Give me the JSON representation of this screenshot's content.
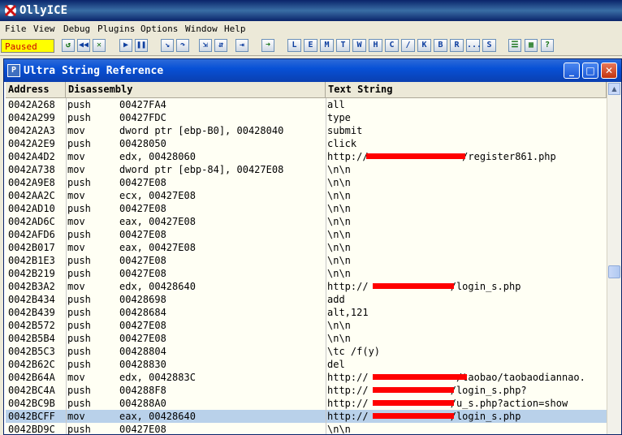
{
  "app": {
    "title": "OllyICE"
  },
  "menu": [
    "File",
    "View",
    "Debug",
    "Plugins",
    "Options",
    "Window",
    "Help"
  ],
  "toolbar": {
    "status": "Paused",
    "letters": [
      "L",
      "E",
      "M",
      "T",
      "W",
      "H",
      "C",
      "/",
      "K",
      "B",
      "R",
      "...",
      "S"
    ]
  },
  "window": {
    "title": "Ultra String Reference",
    "icon_letter": "P",
    "buttons": {
      "minimize": "_",
      "maximize": "□",
      "close": "✕"
    }
  },
  "table": {
    "columns": [
      "Address",
      "Disassembly",
      "Text String"
    ],
    "rows": [
      {
        "addr": "0042A268",
        "op": "push",
        "arg": "00427FA4",
        "text": "all"
      },
      {
        "addr": "0042A299",
        "op": "push",
        "arg": "00427FDC",
        "text": "type"
      },
      {
        "addr": "0042A2A3",
        "op": "mov",
        "arg": "dword ptr [ebp-B0], 00428040",
        "text": "submit"
      },
      {
        "addr": "0042A2E9",
        "op": "push",
        "arg": "00428050",
        "text": "click"
      },
      {
        "addr": "0042A4D2",
        "op": "mov",
        "arg": "edx, 00428060",
        "text": "http://                /register861.php"
      },
      {
        "addr": "0042A738",
        "op": "mov",
        "arg": "dword ptr [ebp-84], 00427E08",
        "text": "\\n\\n"
      },
      {
        "addr": "0042A9E8",
        "op": "push",
        "arg": "00427E08",
        "text": "\\n\\n"
      },
      {
        "addr": "0042AA2C",
        "op": "mov",
        "arg": "ecx, 00427E08",
        "text": "\\n\\n"
      },
      {
        "addr": "0042AD10",
        "op": "push",
        "arg": "00427E08",
        "text": "\\n\\n"
      },
      {
        "addr": "0042AD6C",
        "op": "mov",
        "arg": "eax, 00427E08",
        "text": "\\n\\n"
      },
      {
        "addr": "0042AFD6",
        "op": "push",
        "arg": "00427E08",
        "text": "\\n\\n"
      },
      {
        "addr": "0042B017",
        "op": "mov",
        "arg": "eax, 00427E08",
        "text": "\\n\\n"
      },
      {
        "addr": "0042B1E3",
        "op": "push",
        "arg": "00427E08",
        "text": "\\n\\n"
      },
      {
        "addr": "0042B219",
        "op": "push",
        "arg": "00427E08",
        "text": "\\n\\n"
      },
      {
        "addr": "0042B3A2",
        "op": "mov",
        "arg": "edx, 00428640",
        "text": "http://              /login_s.php"
      },
      {
        "addr": "0042B434",
        "op": "push",
        "arg": "00428698",
        "text": "add"
      },
      {
        "addr": "0042B439",
        "op": "push",
        "arg": "00428684",
        "text": "alt,121"
      },
      {
        "addr": "0042B572",
        "op": "push",
        "arg": "00427E08",
        "text": "\\n\\n"
      },
      {
        "addr": "0042B5B4",
        "op": "push",
        "arg": "00427E08",
        "text": "\\n\\n"
      },
      {
        "addr": "0042B5C3",
        "op": "push",
        "arg": "00428804",
        "text": "\\tc /f(y)"
      },
      {
        "addr": "0042B62C",
        "op": "push",
        "arg": "00428830",
        "text": "del"
      },
      {
        "addr": "0042B64A",
        "op": "mov",
        "arg": "edx, 0042883C",
        "text": "http://               /taobao/taobaodiannao."
      },
      {
        "addr": "0042BC4A",
        "op": "push",
        "arg": "004288F8",
        "text": "http://              /login_s.php?"
      },
      {
        "addr": "0042BC9B",
        "op": "push",
        "arg": "004288A0",
        "text": "http://              /u_s.php?action=show"
      },
      {
        "addr": "0042BCFF",
        "op": "mov",
        "arg": "eax, 00428640",
        "text": "http://              /login_s.php"
      },
      {
        "addr": "0042BD9C",
        "op": "push",
        "arg": "00427E08",
        "text": "\\n\\n"
      }
    ],
    "selected_index": 24
  },
  "colors": {
    "selection": "#b9d1ea",
    "redaction": "#ff0000",
    "status_bg": "#ffff00"
  }
}
